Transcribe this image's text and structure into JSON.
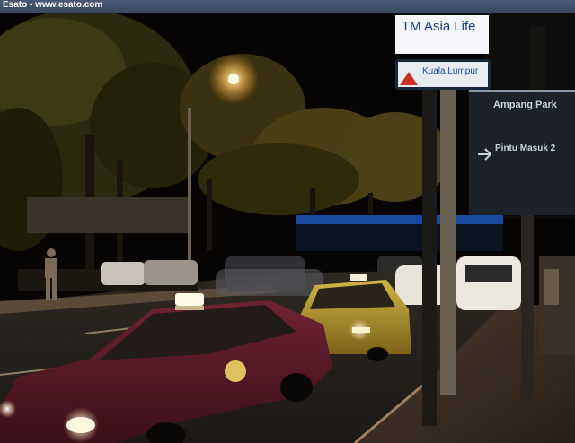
{
  "watermark": {
    "text": "Esato - www.esato.com"
  },
  "signs": {
    "tm_asia_life": "TM Asia Life",
    "kl_sign": "Kuala Lumpur",
    "ampang_park": "Ampang Park",
    "pintu_masuk": "Pintu Masuk 2"
  },
  "scene": {
    "description_colors": {
      "sky": "#050402",
      "foliage": "#3a3a12",
      "road": "#2a2420",
      "taxi_red": "#5a1a26",
      "taxi_yellow": "#b89a2a",
      "streetlight": "#ffd27a"
    }
  }
}
